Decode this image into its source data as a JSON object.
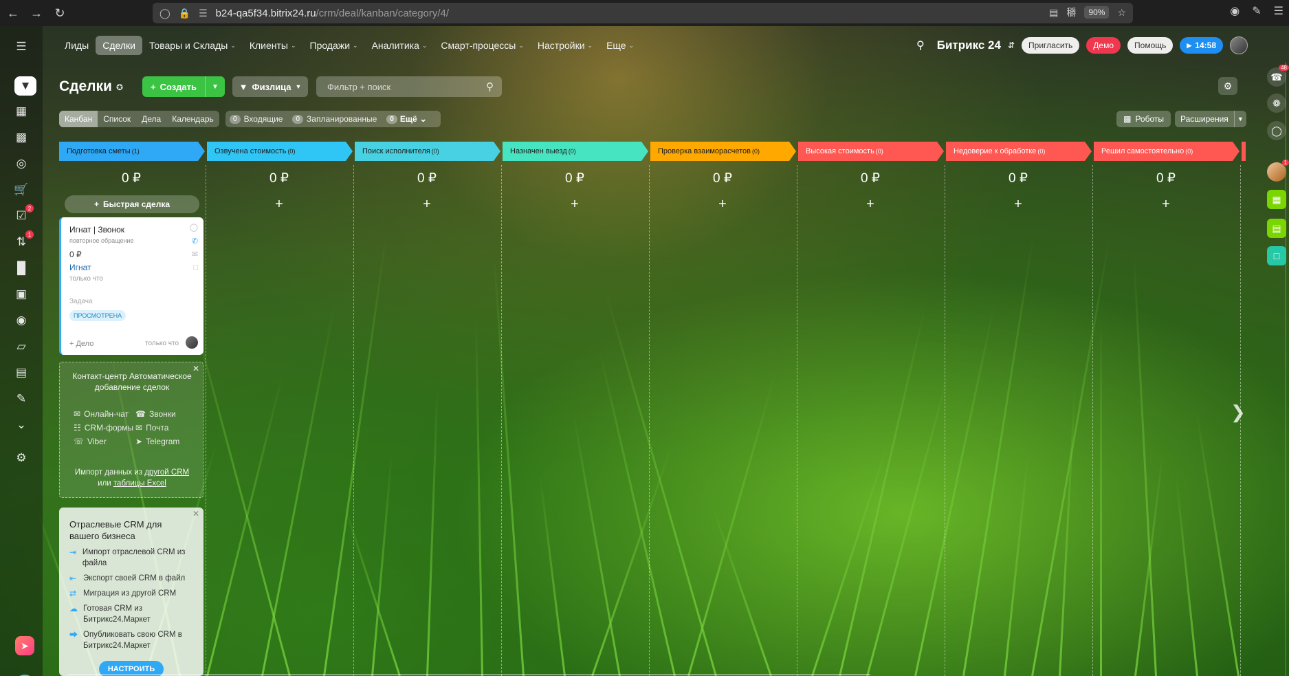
{
  "browser": {
    "url_host": "b24-qa5f34.bitrix24.ru",
    "url_path": "/crm/deal/kanban/category/4/",
    "zoom": "90%"
  },
  "topmenu": {
    "items": [
      {
        "label": "Лиды",
        "arrow": false,
        "active": false
      },
      {
        "label": "Сделки",
        "arrow": false,
        "active": true
      },
      {
        "label": "Товары и Склады",
        "arrow": true,
        "active": false
      },
      {
        "label": "Клиенты",
        "arrow": true,
        "active": false
      },
      {
        "label": "Продажи",
        "arrow": true,
        "active": false
      },
      {
        "label": "Аналитика",
        "arrow": true,
        "active": false
      },
      {
        "label": "Смарт-процессы",
        "arrow": true,
        "active": false
      },
      {
        "label": "Настройки",
        "arrow": true,
        "active": false
      },
      {
        "label": "Еще",
        "arrow": true,
        "active": false
      }
    ],
    "logo": "Битрикс 24",
    "invite": "Пригласить",
    "demo": "Демо",
    "help": "Помощь",
    "time": "14:58"
  },
  "sidebar": {
    "badges": {
      "tasks": "2",
      "processes": "1"
    }
  },
  "rightbar": {
    "notifications_count": "48",
    "avatar_count": "1"
  },
  "header": {
    "title": "Сделки",
    "create_label": "Создать",
    "category_label": "Физлица",
    "filter_placeholder": "Фильтр + поиск"
  },
  "views": {
    "items": [
      {
        "label": "Канбан",
        "active": true
      },
      {
        "label": "Список",
        "active": false
      },
      {
        "label": "Дела",
        "active": false
      },
      {
        "label": "Календарь",
        "active": false
      }
    ],
    "counters": [
      {
        "num": "0",
        "label": "Входящие"
      },
      {
        "num": "0",
        "label": "Запланированные"
      },
      {
        "num": "0",
        "label": "Ещё"
      }
    ],
    "robots": "Роботы",
    "extensions": "Расширения"
  },
  "kanban": {
    "quick_deal": "Быстрая сделка",
    "stages": [
      {
        "name": "Подготовка сметы",
        "count": "(1)",
        "sum": "0 ₽",
        "color": "#2fa9f5",
        "text": "#1a1a1a"
      },
      {
        "name": "Озвучена стоимость",
        "count": "(0)",
        "sum": "0 ₽",
        "color": "#2fc6f6",
        "text": "#1a1a1a"
      },
      {
        "name": "Поиск исполнителя",
        "count": "(0)",
        "sum": "0 ₽",
        "color": "#47d1e2",
        "text": "#1a1a1a"
      },
      {
        "name": "Назначен выезд",
        "count": "(0)",
        "sum": "0 ₽",
        "color": "#47e4c2",
        "text": "#1a1a1a"
      },
      {
        "name": "Проверка взаиморасчетов",
        "count": "(0)",
        "sum": "0 ₽",
        "color": "#ffa900",
        "text": "#1a1a1a"
      },
      {
        "name": "Высокая стоимость",
        "count": "(0)",
        "sum": "0 ₽",
        "color": "#ff5752",
        "text": "#ffffff"
      },
      {
        "name": "Недоверие к обработке",
        "count": "(0)",
        "sum": "0 ₽",
        "color": "#ff5752",
        "text": "#ffffff"
      },
      {
        "name": "Решил самостоятельно",
        "count": "(0)",
        "sum": "0 ₽",
        "color": "#ff5752",
        "text": "#ffffff"
      }
    ]
  },
  "card": {
    "title": "Игнат | Звонок",
    "subtitle": "повторное обращение",
    "sum": "0 ₽",
    "contact": "Игнат",
    "created": "только что",
    "task_label": "Задача",
    "status": "ПРОСМОТРЕНА",
    "add_activity": "+ Дело",
    "activity_time": "только что"
  },
  "contact_center": {
    "title": "Контакт-центр Автоматическое добавление сделок",
    "items": [
      "Онлайн-чат",
      "Звонки",
      "CRM-формы",
      "Почта",
      "Viber",
      "Telegram"
    ],
    "import_prefix": "Импорт данных из",
    "import_link1": "другой CRM",
    "import_mid": "или",
    "import_link2": "таблицы Excel"
  },
  "industry": {
    "title": "Отраслевые CRM для вашего бизнеса",
    "items": [
      "Импорт отраслевой CRM из файла",
      "Экспорт своей CRM в файл",
      "Миграция из другой CRM",
      "Готовая CRM из Битрикс24.Маркет",
      "Опубликовать свою CRM в Битрикс24.Маркет"
    ],
    "button": "НАСТРОИТЬ"
  }
}
